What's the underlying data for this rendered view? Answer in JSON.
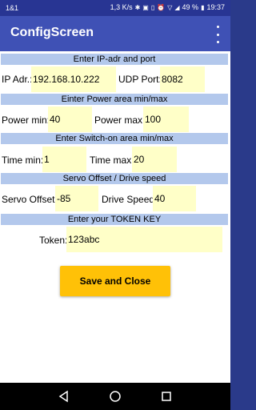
{
  "status_bar": {
    "carrier": "1&1",
    "net_speed": "1,3 K/s",
    "battery": "49 %",
    "time": "19:37"
  },
  "app_bar": {
    "title": "ConfigScreen",
    "menu_icon": "more-vert-icon"
  },
  "sections": {
    "ip_port": {
      "header": "Enter IP-adr and port",
      "ip_label": "IP Adr.:",
      "ip_value": "192.168.10.222",
      "port_label": "UDP Port:",
      "port_value": "8082"
    },
    "power": {
      "header": "Einter Power area min/max",
      "min_label": "Power min:",
      "min_value": "40",
      "max_label": "Power max:",
      "max_value": "100"
    },
    "switch_on": {
      "header": "Enter Switch-on area min/max",
      "min_label": "Time min:",
      "min_value": "1",
      "max_label": "Time max:",
      "max_value": "20"
    },
    "servo": {
      "header": "Servo Offset / Drive speed",
      "offset_label": "Servo Offset:",
      "offset_value": "-85",
      "speed_label": "Drive Speed:",
      "speed_value": "40"
    },
    "token": {
      "header": "Enter your TOKEN KEY",
      "label": "Token:",
      "value": "123abc"
    }
  },
  "save_button": {
    "label": "Save and Close"
  },
  "colors": {
    "app_bar": "#3f51b5",
    "status_bar": "#283593",
    "section_header": "#b3c8ec",
    "input_bg": "#ffffc8",
    "button": "#ffc107"
  }
}
